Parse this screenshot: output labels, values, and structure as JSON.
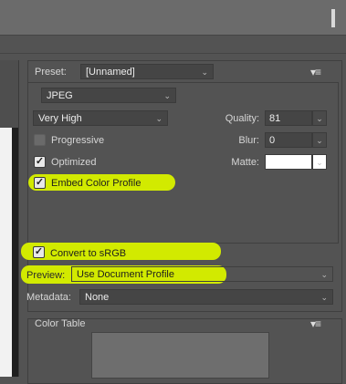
{
  "preset": {
    "label": "Preset:",
    "value": "[Unnamed]"
  },
  "format": {
    "value": "JPEG"
  },
  "quality_preset": {
    "value": "Very High"
  },
  "quality": {
    "label": "Quality:",
    "value": "81"
  },
  "blur": {
    "label": "Blur:",
    "value": "0"
  },
  "matte": {
    "label": "Matte:",
    "value": ""
  },
  "options": {
    "progressive": {
      "label": "Progressive",
      "checked": false
    },
    "optimized": {
      "label": "Optimized",
      "checked": true
    },
    "embed_profile": {
      "label": "Embed Color Profile",
      "checked": true
    },
    "convert_srgb": {
      "label": "Convert to sRGB",
      "checked": true
    }
  },
  "preview": {
    "label": "Preview:",
    "value": "Use Document Profile"
  },
  "metadata": {
    "label": "Metadata:",
    "value": "None"
  },
  "color_table": {
    "label": "Color Table"
  },
  "glyphs": {
    "check": "✓",
    "arrow": "⌄",
    "menu": "▾≡"
  },
  "colors": {
    "highlight": "#d2ea00",
    "panel_bg": "#535353"
  }
}
